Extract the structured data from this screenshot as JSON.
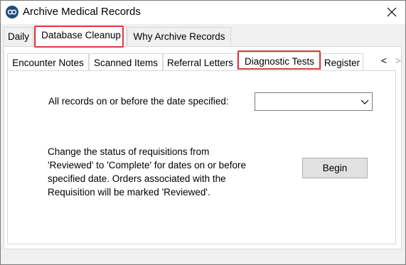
{
  "window": {
    "title": "Archive Medical Records",
    "app_icon": "op-logo-icon",
    "close_icon": "close-icon"
  },
  "top_tabs": [
    {
      "label": "Daily"
    },
    {
      "label": "Database Cleanup",
      "active": true,
      "highlighted": true
    },
    {
      "label": "Why Archive Records"
    }
  ],
  "inner_tabs": [
    {
      "label": "Encounter Notes"
    },
    {
      "label": "Scanned Items"
    },
    {
      "label": "Referral Letters"
    },
    {
      "label": "Diagnostic Tests",
      "active": true,
      "highlighted": true
    },
    {
      "label": "Register"
    }
  ],
  "scroll": {
    "left": "<",
    "right": ">"
  },
  "form": {
    "date_label": "All records on or before the date specified:",
    "date_value": "",
    "description": "Change the status of requisitions from\n'Reviewed' to 'Complete' for dates on or before\nspecified date. Orders associated with the\nRequisition will be marked 'Reviewed'.",
    "begin_label": "Begin"
  },
  "colors": {
    "highlight": "#e0393e",
    "icon_blue": "#1f4e79"
  }
}
